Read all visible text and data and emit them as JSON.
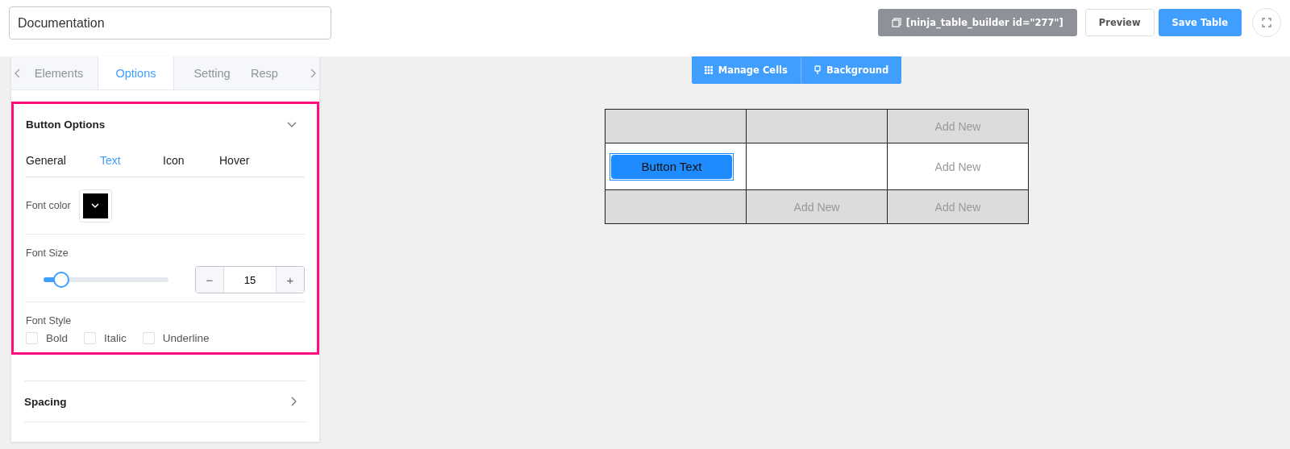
{
  "title_field": {
    "value": "Documentation"
  },
  "header_buttons": [
    {
      "kind": "shortcode",
      "label": "[ninja_table_builder id=\"277\"]"
    },
    {
      "kind": "plain",
      "label": "Preview"
    },
    {
      "kind": "primary",
      "label": "Save Table"
    },
    {
      "kind": "fullscreen"
    }
  ],
  "sidebar": {
    "tabs": [
      {
        "label": "Elements",
        "selected": false
      },
      {
        "label": "Options",
        "selected": true
      },
      {
        "label": "Setting",
        "selected": false
      },
      {
        "label": "Resp",
        "selected": false
      }
    ],
    "sections": [
      {
        "title": "Button Options",
        "expanded": true,
        "highlighted": true,
        "subtabs": [
          {
            "label": "General",
            "selected": false
          },
          {
            "label": "Text",
            "selected": true
          },
          {
            "label": "Icon",
            "selected": false
          },
          {
            "label": "Hover",
            "selected": false
          }
        ],
        "font_color": {
          "label": "Font color",
          "color": "#000000"
        },
        "font_size": {
          "label": "Font Size",
          "level": 0.12,
          "value": "15",
          "minus": "−",
          "plus": "+"
        },
        "font_style": {
          "label": "Font Style",
          "options": [
            {
              "label": "Bold",
              "checked": false
            },
            {
              "label": "Italic",
              "checked": false
            },
            {
              "label": "Underline",
              "checked": false
            }
          ]
        }
      },
      {
        "title": "Spacing",
        "expanded": false,
        "highlighted": false
      }
    ]
  },
  "toolbar": [
    {
      "kind": "grid",
      "label": "Manage Cells"
    },
    {
      "kind": "brush",
      "label": "Background"
    }
  ],
  "table": {
    "rows": [
      {
        "shaded": true,
        "cells": [
          {
            "kind": "empty"
          },
          {
            "kind": "empty"
          },
          {
            "kind": "add",
            "text": "Add New"
          }
        ]
      },
      {
        "shaded": false,
        "cells": [
          {
            "kind": "button",
            "text": "Button Text",
            "selected": true
          },
          {
            "kind": "empty"
          },
          {
            "kind": "add",
            "text": "Add New"
          }
        ]
      },
      {
        "shaded": true,
        "cells": [
          {
            "kind": "empty"
          },
          {
            "kind": "add",
            "text": "Add New"
          },
          {
            "kind": "add",
            "text": "Add New"
          }
        ]
      }
    ]
  }
}
